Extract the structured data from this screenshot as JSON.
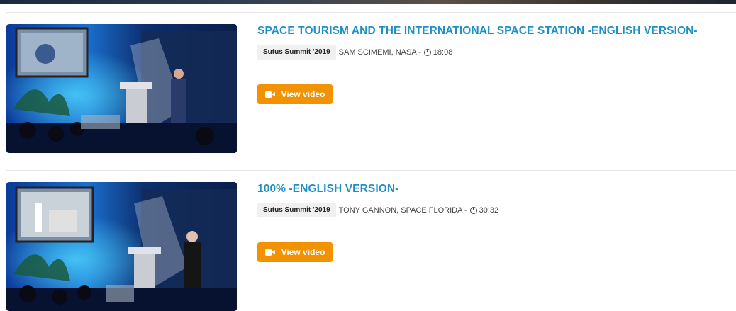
{
  "videos": [
    {
      "title": "SPACE TOURISM AND THE INTERNATIONAL SPACE STATION -ENGLISH VERSION-",
      "event": "Sutus Summit '2019",
      "speaker": "SAM SCIMEMI, NASA -",
      "duration": "18:08",
      "button_label": "View video",
      "thumbnail_icon": "conference-stage-thumbnail"
    },
    {
      "title": "100% -ENGLISH VERSION-",
      "event": "Sutus Summit '2019",
      "speaker": "TONY GANNON, SPACE FLORIDA -",
      "duration": "30:32",
      "button_label": "View video",
      "thumbnail_icon": "conference-stage-thumbnail"
    }
  ],
  "colors": {
    "title": "#1f8fc4",
    "button": "#f39200",
    "badge_bg": "#f0f0f0"
  }
}
